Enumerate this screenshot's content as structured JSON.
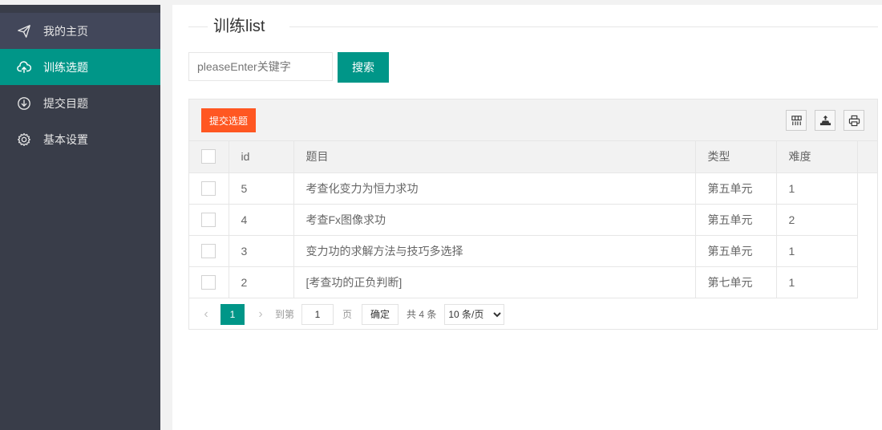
{
  "sidebar": {
    "items": [
      {
        "label": "我的主页",
        "icon": "paper-plane-icon"
      },
      {
        "label": "训练选题",
        "icon": "cloud-upload-icon"
      },
      {
        "label": "提交目题",
        "icon": "download-circle-icon"
      },
      {
        "label": "基本设置",
        "icon": "gear-icon"
      }
    ],
    "active_index": 1
  },
  "main": {
    "title": "训练list",
    "search": {
      "placeholder": "pleaseEnter关键字",
      "value": "",
      "button_label": "搜索"
    },
    "toolbar": {
      "submit_label": "提交选题",
      "icons": [
        "columns-icon",
        "export-icon",
        "print-icon"
      ]
    },
    "table": {
      "headers": {
        "id": "id",
        "question": "题目",
        "type": "类型",
        "difficulty": "难度"
      },
      "rows": [
        {
          "id": "5",
          "question": "考查化变力为恒力求功",
          "type": "第五单元",
          "difficulty": "1"
        },
        {
          "id": "4",
          "question": "考查Fx图像求功",
          "type": "第五单元",
          "difficulty": "2"
        },
        {
          "id": "3",
          "question": "变力功的求解方法与技巧多选择",
          "type": "第五单元",
          "difficulty": "1"
        },
        {
          "id": "2",
          "question": "[考查功的正负判断]",
          "type": "第七单元",
          "difficulty": "1"
        }
      ]
    },
    "pagination": {
      "current_page": "1",
      "goto_prefix": "到第",
      "goto_value": "1",
      "goto_suffix": "页",
      "confirm_label": "确定",
      "total_text": "共 4 条",
      "page_size_label": "10 条/页"
    }
  },
  "colors": {
    "sidebar_bg": "#393d49",
    "accent": "#009688",
    "submit": "#ff5722"
  }
}
